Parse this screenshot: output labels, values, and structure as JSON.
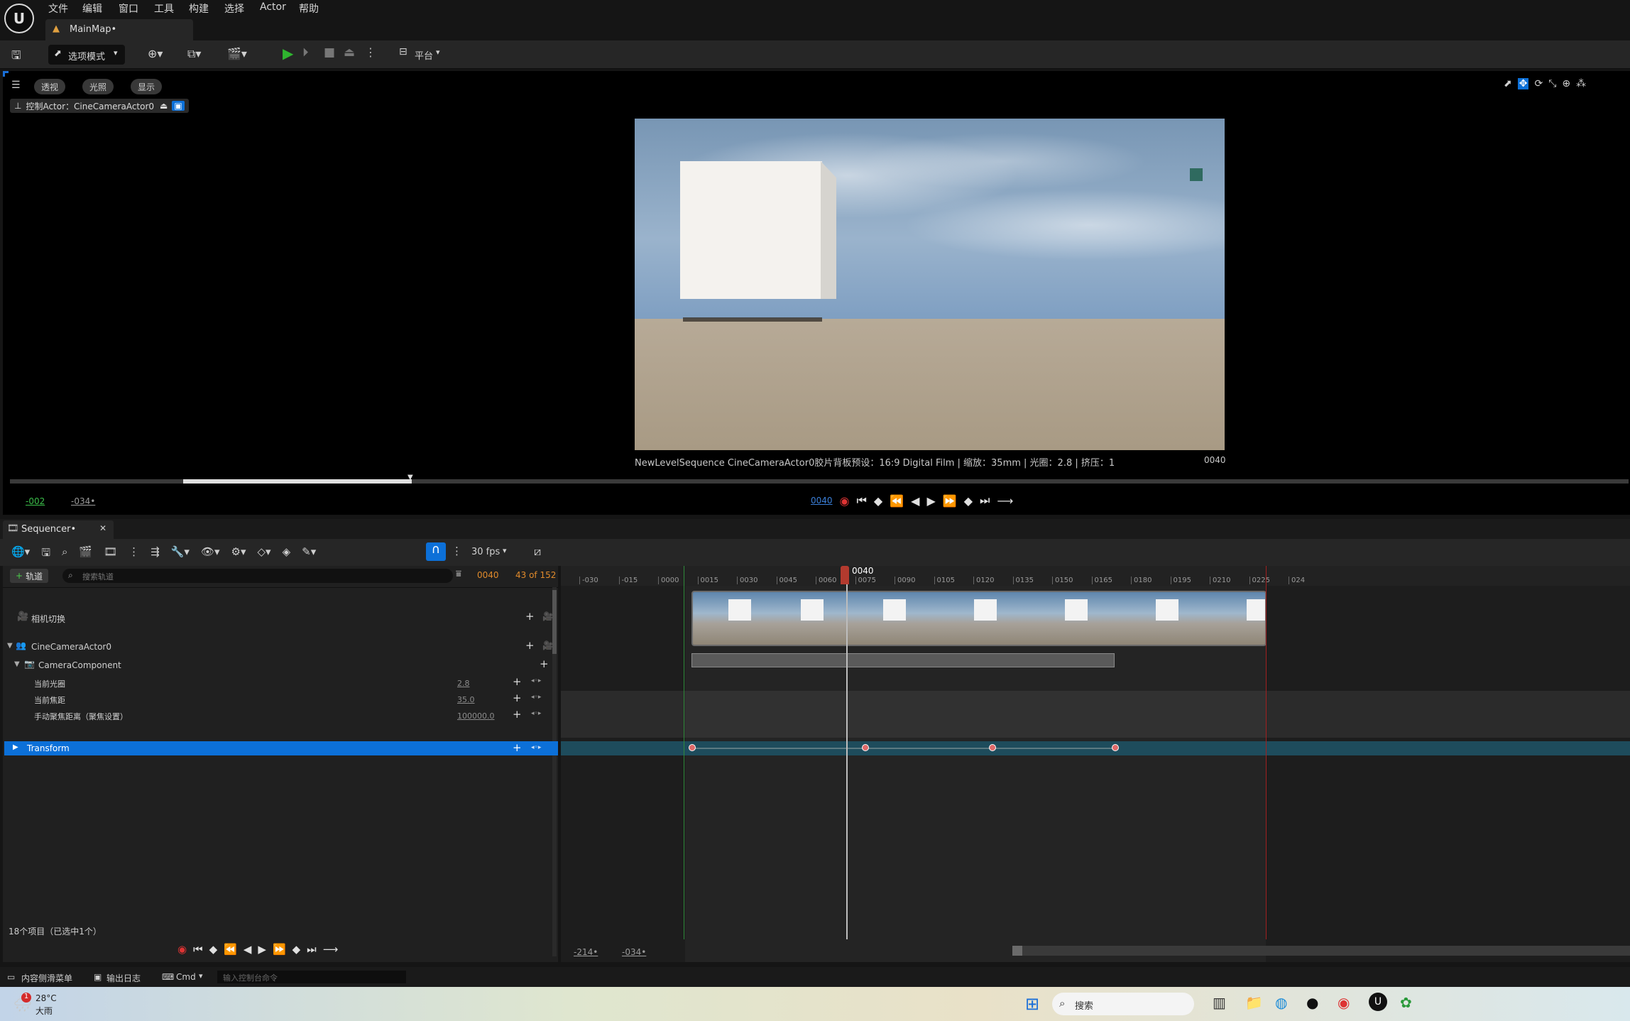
{
  "menu": [
    "文件",
    "编辑",
    "窗口",
    "工具",
    "构建",
    "选择",
    "Actor",
    "帮助"
  ],
  "doc_tab": "MainMap•",
  "toolbar": {
    "mode": "选项模式",
    "platform": "平台"
  },
  "viewport": {
    "chips": [
      "透视",
      "光照",
      "显示"
    ],
    "pilot": "控制Actor：CineCameraActor0",
    "camera_info": "NewLevelSequence CineCameraActor0胶片背板预设：16:9 Digital Film | 缩放：35mm | 光圈：2.8 | 挤压：1",
    "frame": "0040",
    "range_start": "-002",
    "range_end": "-034•",
    "current": "0040"
  },
  "sequencer": {
    "tab": "Sequencer•",
    "fps": "30 fps",
    "add_track": "轨道",
    "search_placeholder": "搜索轨道",
    "current_frame": "0040",
    "frame_count": "43 of 152",
    "playhead": "0040",
    "ruler_ticks": [
      "-030",
      "-015",
      "0000",
      "0015",
      "0030",
      "0045",
      "0060",
      "0075",
      "0090",
      "0105",
      "0120",
      "0135",
      "0150",
      "0165",
      "0180",
      "0195",
      "0210",
      "0225",
      "024"
    ],
    "tracks": {
      "camera_cuts": "相机切换",
      "actor": "CineCameraActor0",
      "component": "CameraComponent",
      "aperture": {
        "label": "当前光圈",
        "value": "2.8"
      },
      "focal": {
        "label": "当前焦距",
        "value": "35.0"
      },
      "focus": {
        "label": "手动聚焦距离（聚焦设置）",
        "value": "100000.0"
      },
      "transform": "Transform"
    },
    "item_count": "18个项目（已选中1个）",
    "bottom_start": "-214•",
    "bottom_end": "-034•"
  },
  "status_bar": {
    "content_drawer": "内容侧滑菜单",
    "output_log": "输出日志",
    "cmd": "Cmd",
    "console_placeholder": "输入控制台命令"
  },
  "taskbar": {
    "weather_temp": "28°C",
    "weather_desc": "大雨",
    "search": "搜索",
    "badge": "1"
  },
  "colors": {
    "accent": "#0c70d8",
    "play_green": "#2fb52f",
    "playhead": "#c0392b",
    "range_start": "#2f8a3a",
    "range_end": "#a02020"
  }
}
